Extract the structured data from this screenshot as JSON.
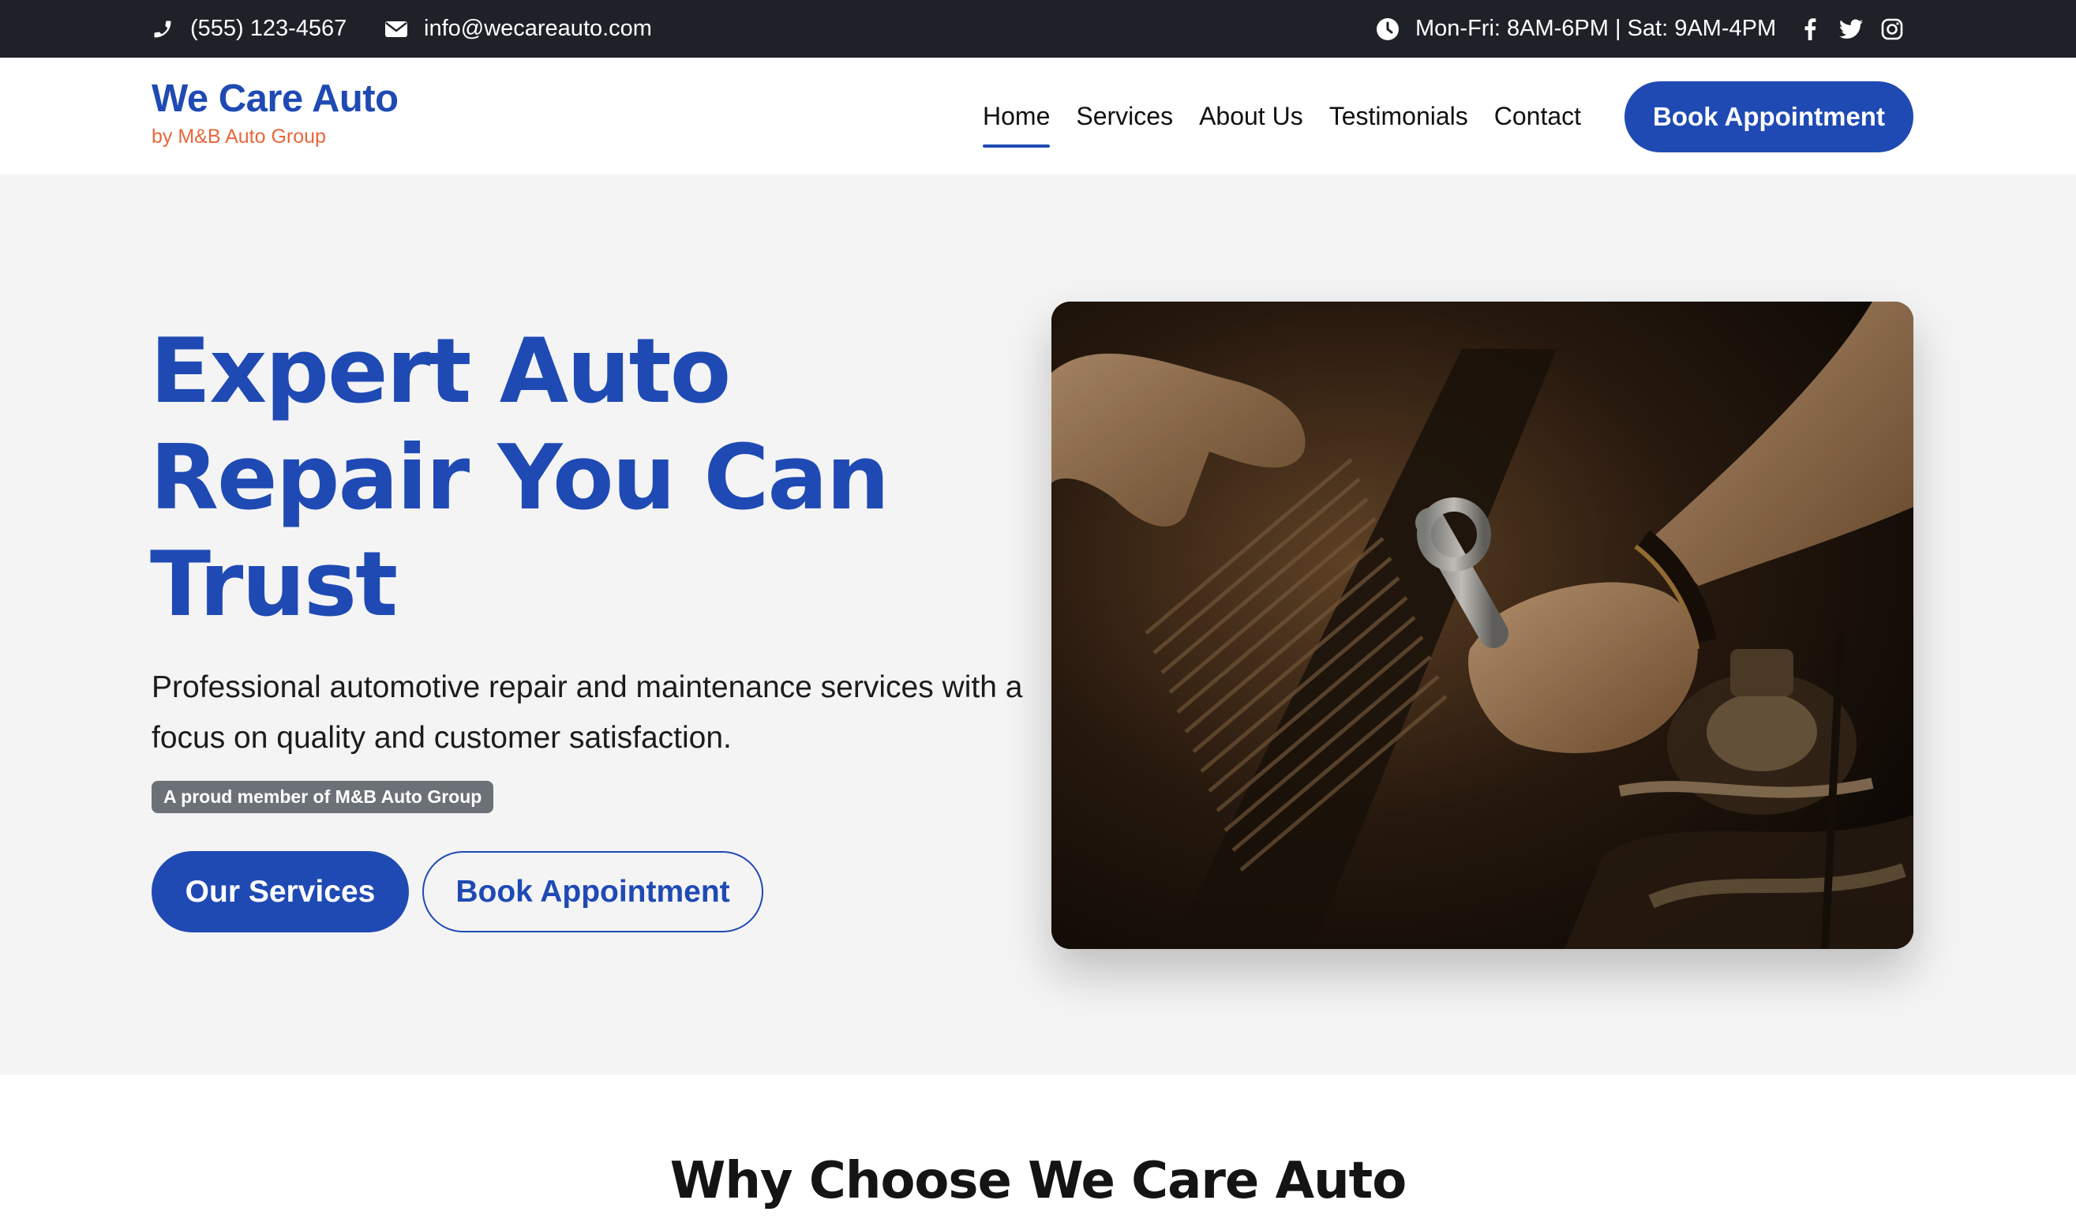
{
  "topbar": {
    "phone": "(555) 123-4567",
    "email": "info@wecareauto.com",
    "hours": "Mon-Fri: 8AM-6PM | Sat: 9AM-4PM",
    "social": [
      "facebook-icon",
      "twitter-icon",
      "instagram-icon"
    ]
  },
  "header": {
    "brand_name": "We Care Auto",
    "brand_sub": "by M&B Auto Group",
    "nav": [
      {
        "label": "Home",
        "active": true
      },
      {
        "label": "Services"
      },
      {
        "label": "About Us"
      },
      {
        "label": "Testimonials"
      },
      {
        "label": "Contact"
      }
    ],
    "cta": "Book Appointment"
  },
  "hero": {
    "title": "Expert Auto Repair You Can Trust",
    "description": "Professional automotive repair and maintenance services with a focus on quality and customer satisfaction.",
    "badge": "A proud member of M&B Auto Group",
    "primary_button": "Our Services",
    "secondary_button": "Book Appointment"
  },
  "why": {
    "title": "Why Choose We Care Auto"
  },
  "colors": {
    "brand_blue": "#1f4ab4",
    "brand_orange": "#e8673b",
    "topbar_bg": "#1e2128",
    "badge_bg": "#6c7178"
  }
}
